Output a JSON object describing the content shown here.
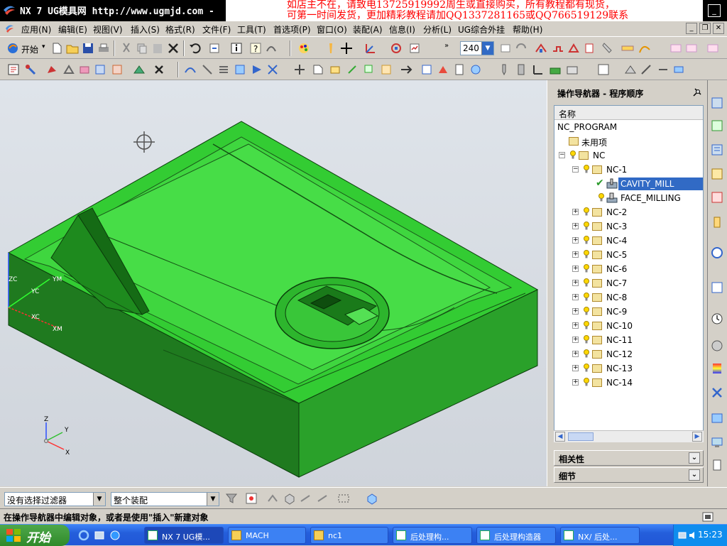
{
  "title_bar": {
    "title": "NX 7 UG模具网 http://www.ugmjd.com -",
    "banner_line1": "如店主不在，请致电13725919992周生或直接购买，所有教程都有现货，",
    "banner_line2": "可第一时间发货，更加精彩教程请加QQ1337281165或QQ766519129联系"
  },
  "menu": [
    "应用(N)",
    "编辑(E)",
    "视图(V)",
    "插入(S)",
    "格式(R)",
    "文件(F)",
    "工具(T)",
    "首选项(P)",
    "窗口(O)",
    "装配(A)",
    "信息(I)",
    "分析(L)",
    "UG综合外挂",
    "帮助(H)"
  ],
  "toolbar": {
    "start_label": "开始",
    "selection_count": "240"
  },
  "viewport": {
    "axis_labels": {
      "zc": "ZC",
      "ym": "YM",
      "yc": "YC",
      "xc": "XC",
      "xm": "XM",
      "triad_z": "Z",
      "triad_y": "Y",
      "triad_x": "X"
    }
  },
  "navigator": {
    "title": "操作导航器 - 程序顺序",
    "column_header": "名称",
    "root": "NC_PROGRAM",
    "unused": "未用项",
    "nc": "NC",
    "nc1": "NC-1",
    "op_selected": "CAVITY_MILL",
    "op_second": "FACE_MILLING",
    "groups": [
      "NC-2",
      "NC-3",
      "NC-4",
      "NC-5",
      "NC-6",
      "NC-7",
      "NC-8",
      "NC-9",
      "NC-10",
      "NC-11",
      "NC-12",
      "NC-13",
      "NC-14"
    ],
    "panel_dependencies": "相关性",
    "panel_details": "细节"
  },
  "filter_bar": {
    "selection_filter": "没有选择过滤器",
    "assembly_scope": "整个装配"
  },
  "status": {
    "message": "在操作导航器中编辑对象，或者是使用\"插入\"新建对象"
  },
  "taskbar": {
    "start": "开始",
    "tasks": [
      "NX 7 UG模...",
      "MACH",
      "nc1",
      "后处理构...",
      "后处理构造器",
      "NX/ 后处..."
    ],
    "clock": "15:23"
  },
  "colors": {
    "part_green": "#33cc33",
    "banner_red": "#ff0000",
    "selection_blue": "#316ac5"
  }
}
